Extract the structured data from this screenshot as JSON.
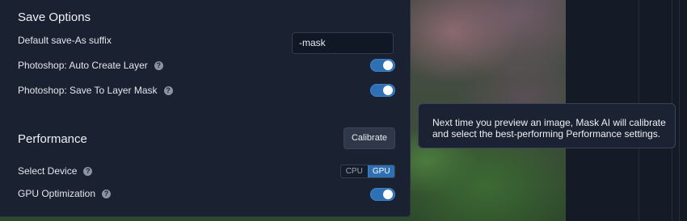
{
  "save_options": {
    "title": "Save Options",
    "suffix_label": "Default save-As suffix",
    "suffix_value": "-mask",
    "auto_create_label": "Photoshop: Auto Create Layer",
    "auto_create_on": true,
    "layer_mask_label": "Photoshop: Save To Layer Mask",
    "layer_mask_on": true
  },
  "performance": {
    "title": "Performance",
    "calibrate_label": "Calibrate",
    "device_label": "Select Device",
    "device_options": [
      "CPU",
      "GPU"
    ],
    "device_selected": "GPU",
    "gpu_opt_label": "GPU Optimization",
    "gpu_opt_on": true
  },
  "tooltip": {
    "line1": "Next time you preview an image, Mask AI will calibrate",
    "line2": "and select the best-performing Performance settings."
  },
  "icons": {
    "help": "help-circle-icon"
  },
  "colors": {
    "accent": "#2f6fb4",
    "panel": "#1a2130"
  }
}
